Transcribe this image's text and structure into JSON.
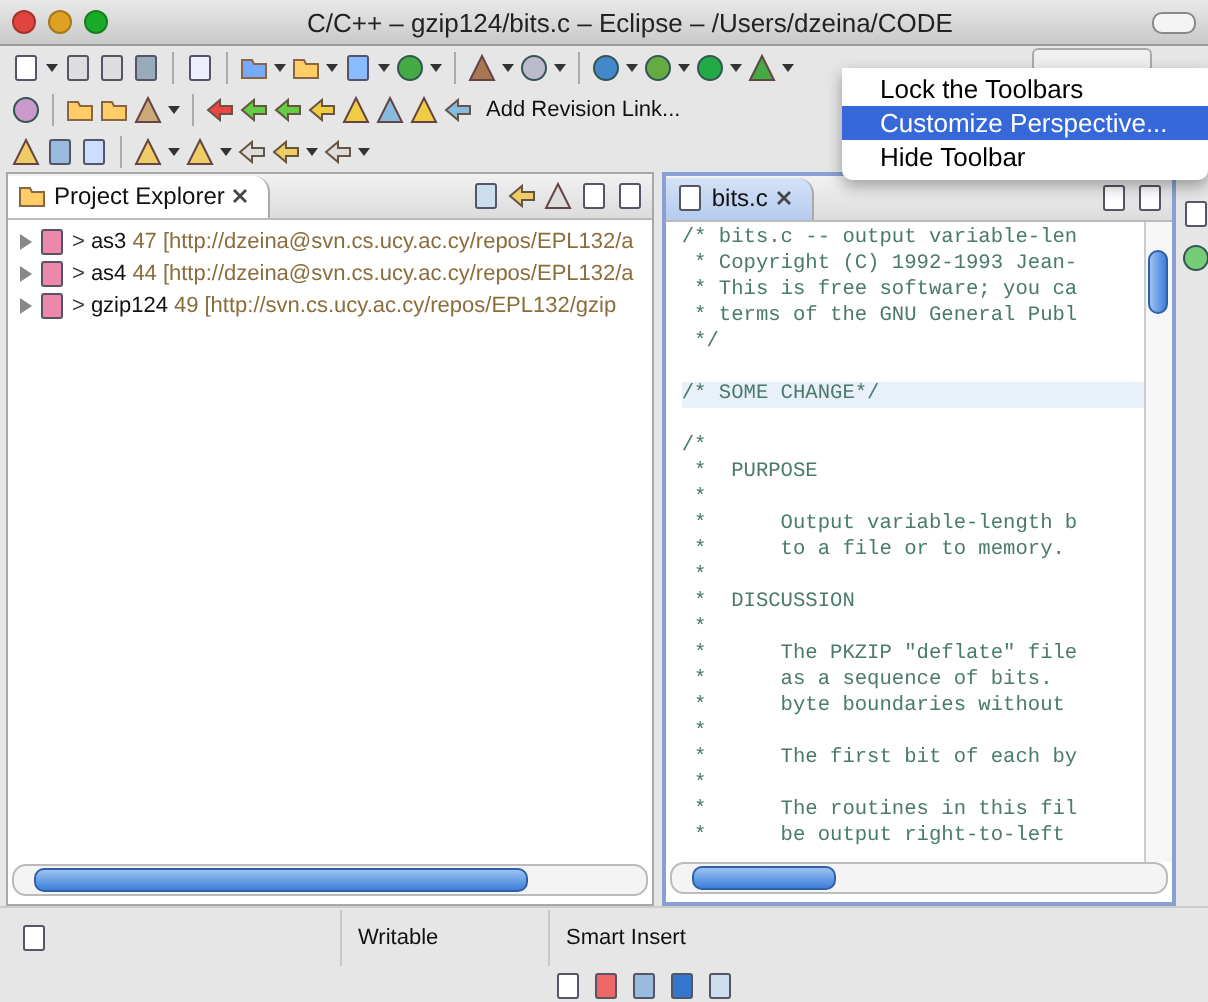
{
  "window": {
    "title": "C/C++ – gzip124/bits.c – Eclipse – /Users/dzeina/CODE"
  },
  "toolbar": {
    "link_label": "Add Revision Link..."
  },
  "context_menu": [
    {
      "label": "Lock the Toolbars",
      "selected": false
    },
    {
      "label": "Customize Perspective...",
      "selected": true
    },
    {
      "label": "Hide Toolbar",
      "selected": false
    }
  ],
  "project_explorer": {
    "tab": {
      "label": "Project Explorer",
      "active": false
    },
    "items": [
      {
        "marker": ">",
        "name": "as3",
        "revision": "47",
        "url": "[http://dzeina@svn.cs.ucy.ac.cy/repos/EPL132/a",
        "expanded": false
      },
      {
        "marker": ">",
        "name": "as4",
        "revision": "44",
        "url": "[http://dzeina@svn.cs.ucy.ac.cy/repos/EPL132/a",
        "expanded": false
      },
      {
        "marker": ">",
        "name": "gzip124",
        "revision": "49",
        "url": "[http://svn.cs.ucy.ac.cy/repos/EPL132/gzip",
        "expanded": false
      }
    ]
  },
  "editor": {
    "tab": {
      "label": "bits.c",
      "active": true
    },
    "lines": [
      {
        "kind": "code",
        "text": "/* bits.c -- output variable-len",
        "current": false
      },
      {
        "kind": "code",
        "text": " * Copyright (C) 1992-1993 Jean-",
        "current": false
      },
      {
        "kind": "code",
        "text": " * This is free software; you ca",
        "current": false
      },
      {
        "kind": "code",
        "text": " * terms of the GNU General Publ",
        "current": false
      },
      {
        "kind": "code",
        "text": " */",
        "current": false
      },
      {
        "kind": "blank",
        "current": false
      },
      {
        "kind": "code",
        "text": "/* SOME CHANGE*/",
        "current": true
      },
      {
        "kind": "blank",
        "current": false
      },
      {
        "kind": "code",
        "text": "/*",
        "current": false
      },
      {
        "kind": "code",
        "text": " *  PURPOSE",
        "current": false
      },
      {
        "kind": "code",
        "text": " *",
        "current": false
      },
      {
        "kind": "code",
        "text": " *      Output variable-length b",
        "current": false
      },
      {
        "kind": "code",
        "text": " *      to a file or to memory.",
        "current": false
      },
      {
        "kind": "code",
        "text": " *",
        "current": false
      },
      {
        "kind": "code",
        "text": " *  DISCUSSION",
        "current": false
      },
      {
        "kind": "code",
        "text": " *",
        "current": false
      },
      {
        "kind": "code",
        "text": " *      The PKZIP \"deflate\" file",
        "current": false
      },
      {
        "kind": "code",
        "text": " *      as a sequence of bits.",
        "current": false
      },
      {
        "kind": "code",
        "text": " *      byte boundaries without",
        "current": false
      },
      {
        "kind": "code",
        "text": " *",
        "current": false
      },
      {
        "kind": "code",
        "text": " *      The first bit of each by",
        "current": false
      },
      {
        "kind": "code",
        "text": " *",
        "current": false
      },
      {
        "kind": "code",
        "text": " *      The routines in this fil",
        "current": false
      },
      {
        "kind": "code",
        "text": " *      be output right-to-left",
        "current": false
      }
    ]
  },
  "status_bar": {
    "fields": [
      "Writable",
      "Smart Insert"
    ]
  }
}
